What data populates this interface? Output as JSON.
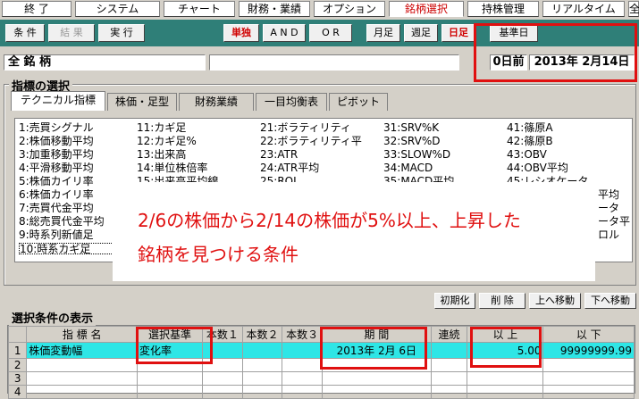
{
  "menu": [
    {
      "label": "終 了"
    },
    {
      "label": "システム"
    },
    {
      "label": "チャート"
    },
    {
      "label": "財務・業績"
    },
    {
      "label": "オプション"
    },
    {
      "label": "銘柄選択"
    },
    {
      "label": "持株管理"
    },
    {
      "label": "リアルタイム"
    },
    {
      "label": "全"
    }
  ],
  "toolbar": {
    "conditions": "条 件",
    "results": "結 果",
    "execute": "実 行",
    "single": "単独",
    "and": "A N D",
    "or": "O R",
    "monthly": "月足",
    "weekly": "週足",
    "daily": "日足",
    "base_date": "基準日"
  },
  "status": {
    "all_stocks": "全 銘 柄",
    "days_before": "0日前",
    "date": "2013年 2月14日"
  },
  "indicator_group": {
    "title": "指標の選択",
    "tabs": [
      "テクニカル指標",
      "株価・足型",
      "財務業績",
      "一目均衡表",
      "ピボット"
    ]
  },
  "indicators": {
    "col1": [
      "1:売買シグナル",
      "2:株価移動平均",
      "3:加重移動平均",
      "4:平滑移動平均",
      "5:株価カイリ率",
      "6:株価カイリ率",
      "7:売買代金平均",
      "8:総売買代金平均",
      "9:時系列新値足",
      "10:時系カギ足"
    ],
    "col2": [
      "11:カギ足",
      "12:カギ足%",
      "13:出来高",
      "14:単位株倍率",
      "15:出来高平均線"
    ],
    "col3": [
      "21:ボラティリティ",
      "22:ボラティリティ平",
      "23:ATR",
      "24:ATR平均",
      "25:ROI"
    ],
    "col4": [
      "31:SRV%K",
      "32:SRV%D",
      "33:SLOW%D",
      "34:MACD",
      "35:MACD平均"
    ],
    "col5": [
      "41:篠原A",
      "42:篠原B",
      "43:OBV",
      "44:OBV平均",
      "45:レシオケータ"
    ],
    "col6_partial": [
      "平均",
      "ータ",
      "ータ平",
      "ロル"
    ]
  },
  "overlay": {
    "line1": "2/6の株価から2/14の株価が5%以上、上昇した",
    "line2": "銘柄を見つける条件"
  },
  "actions": {
    "init": "初期化",
    "delete": "削 除",
    "up": "上へ移動",
    "down": "下へ移動"
  },
  "condition_group": {
    "title": "選択条件の表示",
    "headers": [
      "指 標 名",
      "選択基準",
      "本数１",
      "本数２",
      "本数３",
      "期 間",
      "連続",
      "以 上",
      "以 下"
    ],
    "rows": [
      {
        "no": "1",
        "name": "株価変動幅",
        "criterion": "変化率",
        "period": "2013年 2月 6日",
        "min": "5.00",
        "max": "99999999.99"
      },
      {
        "no": "2"
      },
      {
        "no": "3"
      },
      {
        "no": "4"
      }
    ]
  },
  "colors": {
    "toolbar": "#2f7f78",
    "highlight": "#e01010",
    "selected_row": "#2ee6e6"
  }
}
